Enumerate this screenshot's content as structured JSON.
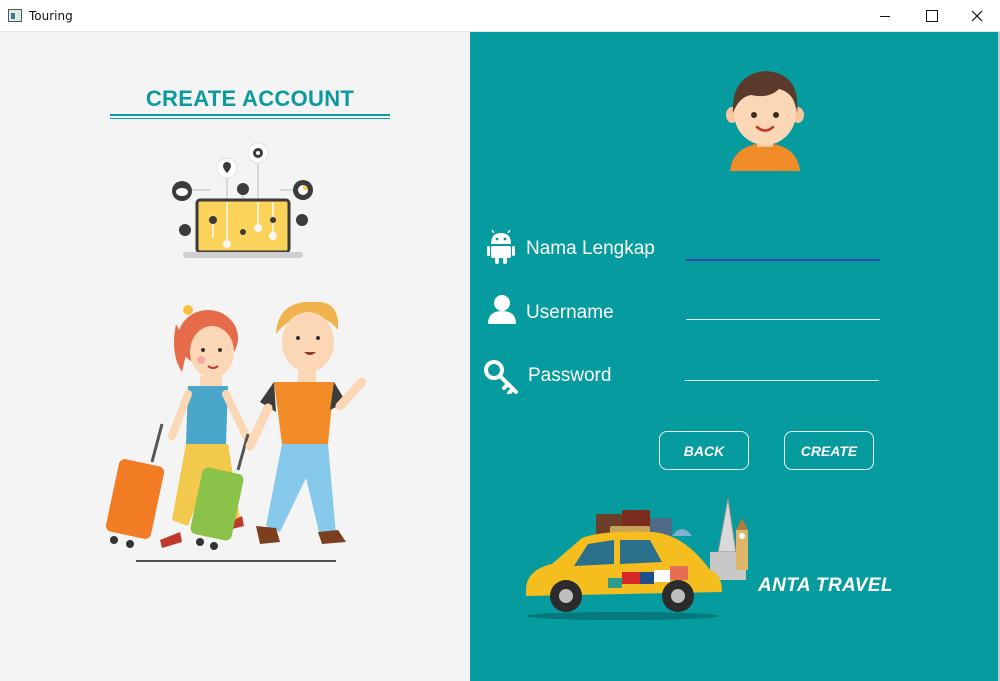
{
  "window": {
    "title": "Touring",
    "controls": {
      "minimize": "minimize",
      "maximize": "maximize",
      "close": "close"
    }
  },
  "left_panel": {
    "heading": "CREATE ACCOUNT",
    "illustrations": [
      "laptop-network-illustration",
      "travelers-with-luggage-illustration"
    ]
  },
  "form": {
    "avatar": "boy-avatar-icon",
    "fields": [
      {
        "label": "Nama Lengkap",
        "icon": "android-icon",
        "value": ""
      },
      {
        "label": "Username",
        "icon": "user-icon",
        "value": ""
      },
      {
        "label": "Password",
        "icon": "key-icon",
        "value": ""
      }
    ],
    "buttons": {
      "back": "BACK",
      "create": "CREATE"
    }
  },
  "brand": {
    "name": "ANTA TRAVEL",
    "illustration": "taxi-with-luggage-illustration"
  },
  "colors": {
    "teal_panel": "#069b9f",
    "heading_teal": "#0b9aa0",
    "left_background": "#f4f4f4"
  }
}
